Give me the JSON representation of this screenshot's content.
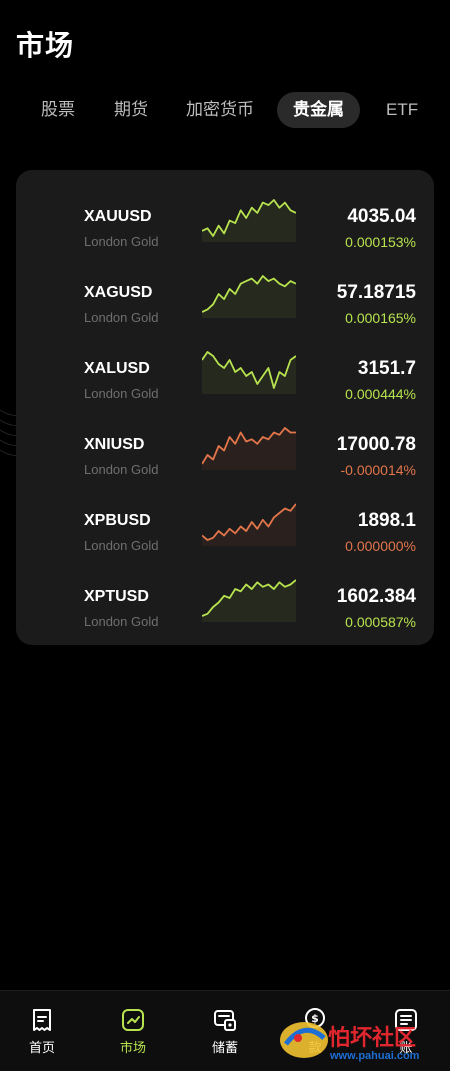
{
  "page": {
    "title": "市场"
  },
  "tabs": [
    {
      "label": "股票",
      "active": false
    },
    {
      "label": "期货",
      "active": false
    },
    {
      "label": "加密货币",
      "active": false
    },
    {
      "label": "贵金属",
      "active": true
    },
    {
      "label": "ETF",
      "active": false
    }
  ],
  "rows": [
    {
      "symbol": "XAUUSD",
      "name": "London Gold",
      "price": "4035.04",
      "change": "0.000153%",
      "trend": "up",
      "spark": [
        14,
        13,
        16,
        12,
        15,
        10,
        11,
        6,
        9,
        5,
        7,
        3,
        4,
        2,
        5,
        3,
        6,
        7
      ]
    },
    {
      "symbol": "XAGUSD",
      "name": "London Gold",
      "price": "57.18715",
      "change": "0.000165%",
      "trend": "up",
      "spark": [
        16,
        15,
        13,
        9,
        11,
        7,
        9,
        5,
        4,
        3,
        5,
        2,
        4,
        3,
        5,
        6,
        4,
        5
      ]
    },
    {
      "symbol": "XALUSD",
      "name": "London Gold",
      "price": "3151.7",
      "change": "0.000444%",
      "trend": "up",
      "spark": [
        6,
        4,
        5,
        7,
        8,
        6,
        9,
        8,
        10,
        9,
        12,
        10,
        8,
        13,
        9,
        10,
        6,
        5
      ]
    },
    {
      "symbol": "XNIUSD",
      "name": "London Gold",
      "price": "17000.78",
      "change": "-0.000014%",
      "trend": "down",
      "spark": [
        18,
        14,
        16,
        10,
        12,
        6,
        9,
        4,
        8,
        7,
        9,
        6,
        7,
        4,
        5,
        2,
        4,
        4
      ]
    },
    {
      "symbol": "XPBUSD",
      "name": "London Gold",
      "price": "1898.1",
      "change": "0.000000%",
      "trend": "down",
      "spark": [
        16,
        18,
        17,
        14,
        16,
        13,
        15,
        12,
        14,
        10,
        13,
        9,
        12,
        8,
        6,
        4,
        5,
        2
      ]
    },
    {
      "symbol": "XPTUSD",
      "name": "London Gold",
      "price": "1602.384",
      "change": "0.000587%",
      "trend": "up",
      "spark": [
        18,
        17,
        14,
        12,
        9,
        10,
        6,
        7,
        4,
        6,
        3,
        5,
        4,
        6,
        3,
        5,
        4,
        2
      ]
    }
  ],
  "nav": [
    {
      "label": "首页",
      "icon": "home-receipt-icon",
      "active": false
    },
    {
      "label": "市场",
      "icon": "market-chart-icon",
      "active": true
    },
    {
      "label": "储蓄",
      "icon": "savings-icon",
      "active": false
    },
    {
      "label": "款",
      "icon": "loan-icon",
      "active": false
    },
    {
      "label": "账",
      "icon": "account-icon",
      "active": false
    }
  ],
  "watermark": {
    "text": "怕坏社区",
    "url": "www.pahuai.com"
  },
  "colors": {
    "up": "#b7e34f",
    "down": "#e2754a",
    "card": "#1b1b1b",
    "bg": "#000000"
  }
}
